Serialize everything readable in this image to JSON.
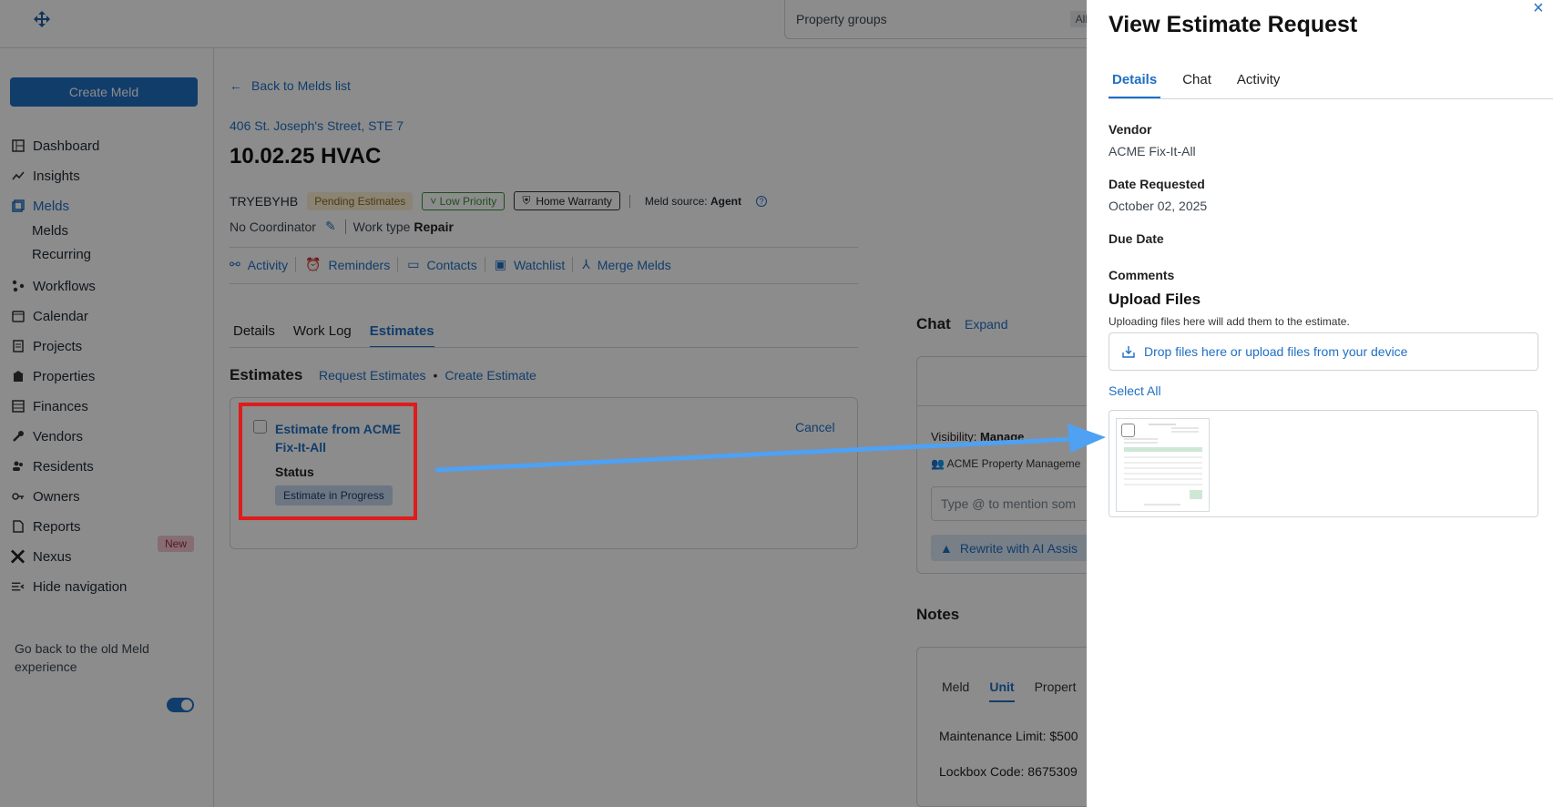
{
  "topbar": {
    "property_groups_label": "Property groups",
    "all_label": "All"
  },
  "sidebar": {
    "create_label": "Create Meld",
    "items": [
      {
        "label": "Dashboard",
        "icon": "dashboard-icon"
      },
      {
        "label": "Insights",
        "icon": "insights-icon"
      },
      {
        "label": "Melds",
        "icon": "melds-icon"
      },
      {
        "label": "Workflows",
        "icon": "workflows-icon"
      },
      {
        "label": "Calendar",
        "icon": "calendar-icon"
      },
      {
        "label": "Projects",
        "icon": "projects-icon"
      },
      {
        "label": "Properties",
        "icon": "properties-icon"
      },
      {
        "label": "Finances",
        "icon": "finances-icon"
      },
      {
        "label": "Vendors",
        "icon": "vendors-icon"
      },
      {
        "label": "Residents",
        "icon": "residents-icon"
      },
      {
        "label": "Owners",
        "icon": "owners-icon"
      },
      {
        "label": "Reports",
        "icon": "reports-icon"
      },
      {
        "label": "Nexus",
        "icon": "nexus-icon"
      },
      {
        "label": "Hide navigation",
        "icon": "hide-nav-icon"
      }
    ],
    "sub_items": [
      "Melds",
      "Recurring"
    ],
    "new_badge": "New",
    "old_experience": "Go back to the old Meld experience"
  },
  "meld": {
    "back_label": "Back to Melds list",
    "address": "406 St. Joseph's Street, STE 7",
    "title": "10.02.25 HVAC",
    "code": "TRYEBYHB",
    "status_badge": "Pending Estimates",
    "priority_badge": "Low Priority",
    "warranty_badge": "Home Warranty",
    "source_label": "Meld source:",
    "source_value": "Agent",
    "coordinator": "No Coordinator",
    "work_type_label": "Work type",
    "work_type_value": "Repair",
    "actions": [
      "Activity",
      "Reminders",
      "Contacts",
      "Watchlist",
      "Merge Melds"
    ],
    "tabs": [
      "Details",
      "Work Log",
      "Estimates"
    ]
  },
  "estimates": {
    "heading": "Estimates",
    "request_link": "Request Estimates",
    "separator": "•",
    "create_link": "Create Estimate",
    "card": {
      "name": "Estimate from ACME Fix-It-All",
      "status_label": "Status",
      "status_value": "Estimate in Progress",
      "cancel": "Cancel"
    }
  },
  "chat": {
    "heading": "Chat",
    "expand": "Expand",
    "visibility": "Visibility:",
    "visibility_value": "Manage",
    "participant": "ACME Property Manageme",
    "placeholder": "Type @ to mention som",
    "rewrite": "Rewrite with AI Assis"
  },
  "notes": {
    "heading": "Notes",
    "tabs": [
      "Meld",
      "Unit",
      "Propert"
    ],
    "maintenance": "Maintenance Limit: $500",
    "lockbox": "Lockbox Code: 8675309"
  },
  "panel": {
    "title": "View Estimate Request",
    "close": "×",
    "tabs": [
      "Details",
      "Chat",
      "Activity"
    ],
    "vendor_label": "Vendor",
    "vendor_value": "ACME Fix-It-All",
    "date_label": "Date Requested",
    "date_value": "October 02, 2025",
    "due_label": "Due Date",
    "comments_label": "Comments",
    "upload_title": "Upload Files",
    "upload_note": "Uploading files here will add them to the estimate.",
    "dropzone": "Drop files here or upload files from your device",
    "select_all": "Select All"
  },
  "colors": {
    "accent": "#1f6fc4",
    "highlight": "#e01b1b",
    "arrow": "#4ea1f3"
  }
}
